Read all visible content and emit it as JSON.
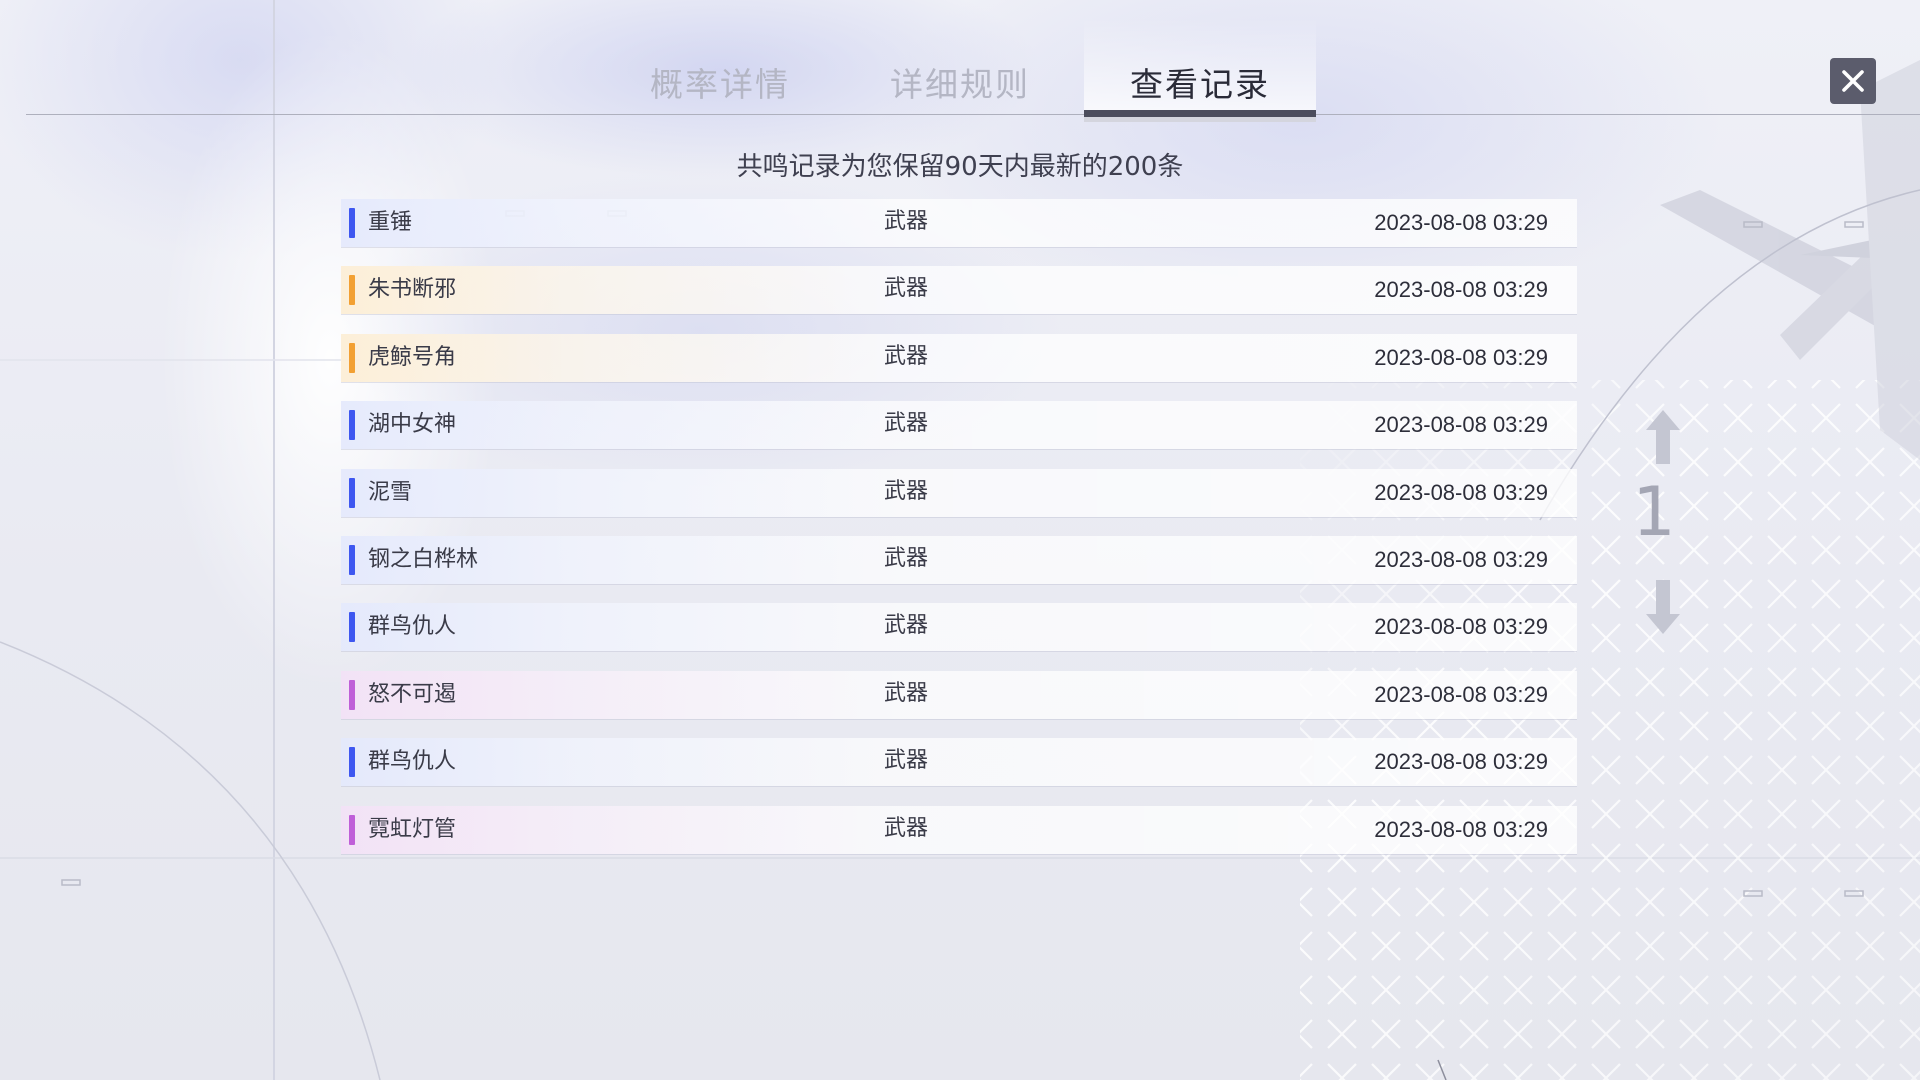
{
  "tabs": [
    {
      "label": "概率详情",
      "active": false
    },
    {
      "label": "详细规则",
      "active": false
    },
    {
      "label": "查看记录",
      "active": true
    }
  ],
  "notice": "共鸣记录为您保留90天内最新的200条",
  "records": [
    {
      "name": "重锤",
      "type": "武器",
      "time": "2023-08-08 03:29",
      "rarity": "blue"
    },
    {
      "name": "朱书断邪",
      "type": "武器",
      "time": "2023-08-08 03:29",
      "rarity": "gold"
    },
    {
      "name": "虎鲸号角",
      "type": "武器",
      "time": "2023-08-08 03:29",
      "rarity": "gold"
    },
    {
      "name": "湖中女神",
      "type": "武器",
      "time": "2023-08-08 03:29",
      "rarity": "blue"
    },
    {
      "name": "泥雪",
      "type": "武器",
      "time": "2023-08-08 03:29",
      "rarity": "blue"
    },
    {
      "name": "钢之白桦林",
      "type": "武器",
      "time": "2023-08-08 03:29",
      "rarity": "blue"
    },
    {
      "name": "群鸟仇人",
      "type": "武器",
      "time": "2023-08-08 03:29",
      "rarity": "blue"
    },
    {
      "name": "怒不可遏",
      "type": "武器",
      "time": "2023-08-08 03:29",
      "rarity": "purple"
    },
    {
      "name": "群鸟仇人",
      "type": "武器",
      "time": "2023-08-08 03:29",
      "rarity": "blue"
    },
    {
      "name": "霓虹灯管",
      "type": "武器",
      "time": "2023-08-08 03:29",
      "rarity": "purple"
    }
  ],
  "rarity_colors": {
    "blue": "#3e57f0",
    "gold": "#f2a033",
    "purple": "#bf5fd8"
  },
  "pager": {
    "page": "1",
    "up_icon": "arrow-up-icon",
    "down_icon": "arrow-down-icon"
  },
  "close_icon": "close-icon"
}
